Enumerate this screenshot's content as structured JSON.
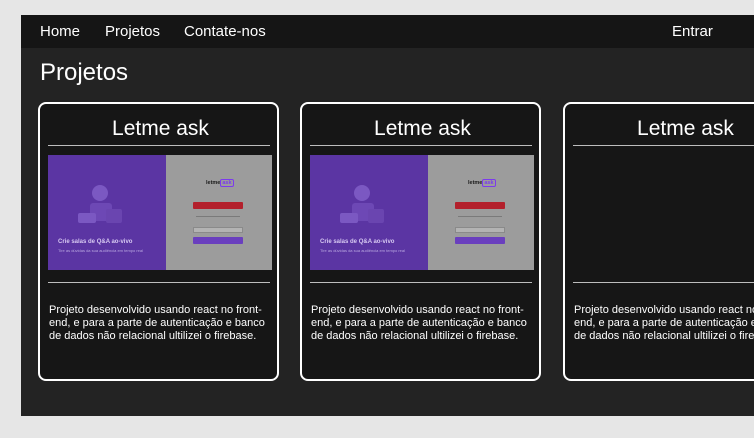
{
  "nav": {
    "home": "Home",
    "projects": "Projetos",
    "contact": "Contate-nos",
    "login": "Entrar"
  },
  "page": {
    "title": "Projetos"
  },
  "cards": [
    {
      "title": "Letme ask",
      "description": "Projeto desenvolvido usando react no front-end, e para a parte de autenticação e banco de dados não relacional ultilizei o firebase.",
      "preview_visible": true,
      "preview": {
        "headline": "Crie salas de Q&A ao-vivo",
        "subtext": "Tire as dúvidas da sua audiência em tempo real",
        "logo_text": "letme",
        "logo_bubble": "ask"
      }
    },
    {
      "title": "Letme ask",
      "description": "Projeto desenvolvido usando react no front-end, e para a parte de autenticação e banco de dados não relacional ultilizei o firebase.",
      "preview_visible": true,
      "preview": {
        "headline": "Crie salas de Q&A ao-vivo",
        "subtext": "Tire as dúvidas da sua audiência em tempo real",
        "logo_text": "letme",
        "logo_bubble": "ask"
      }
    },
    {
      "title": "Letme ask",
      "description": "Projeto desenvolvido usando react no front-end, e para a parte de autenticação e banco de dados não relacional ultilizei o firebase.",
      "preview_visible": false
    }
  ],
  "colors": {
    "page_background": "#e6e6e6",
    "app_background": "#232323",
    "navbar": "#151515",
    "card_background": "#161616",
    "card_border": "#ffffff",
    "preview_purple": "#5b35a3",
    "preview_gray": "#9c9c9c",
    "accent_red": "#b3202c"
  }
}
